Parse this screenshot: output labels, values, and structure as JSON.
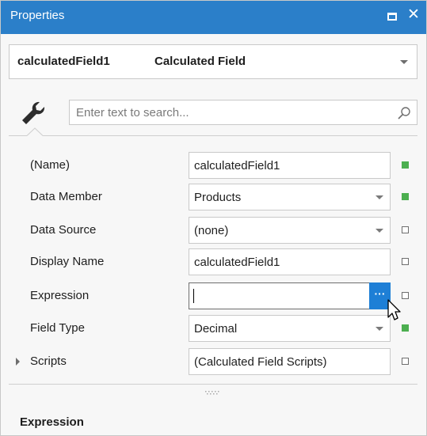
{
  "window": {
    "title": "Properties",
    "maximize_icon": "maximize-icon",
    "close_icon": "close-icon",
    "close_glyph": "✕"
  },
  "object_selector": {
    "name": "calculatedField1",
    "type": "Calculated Field"
  },
  "tab": {
    "icon": "wrench-icon"
  },
  "search": {
    "placeholder": "Enter text to search..."
  },
  "properties": [
    {
      "label": "(Name)",
      "value": "calculatedField1",
      "editor": "text",
      "modified": true
    },
    {
      "label": "Data Member",
      "value": "Products",
      "editor": "dropdown",
      "modified": true
    },
    {
      "label": "Data Source",
      "value": "(none)",
      "editor": "dropdown",
      "modified": false
    },
    {
      "label": "Display Name",
      "value": "calculatedField1",
      "editor": "text",
      "modified": false
    },
    {
      "label": "Expression",
      "value": "",
      "editor": "ellipsis",
      "modified": false,
      "ellipsis_label": "···"
    },
    {
      "label": "Field Type",
      "value": "Decimal",
      "editor": "dropdown",
      "modified": true
    },
    {
      "label": "Scripts",
      "value": "(Calculated Field Scripts)",
      "editor": "text",
      "modified": false,
      "expandable": true
    }
  ],
  "description": {
    "title": "Expression"
  },
  "colors": {
    "title_bar": "#2b7fc9",
    "ellipsis_button": "#1e7fd6",
    "modified_marker": "#4caf50"
  }
}
